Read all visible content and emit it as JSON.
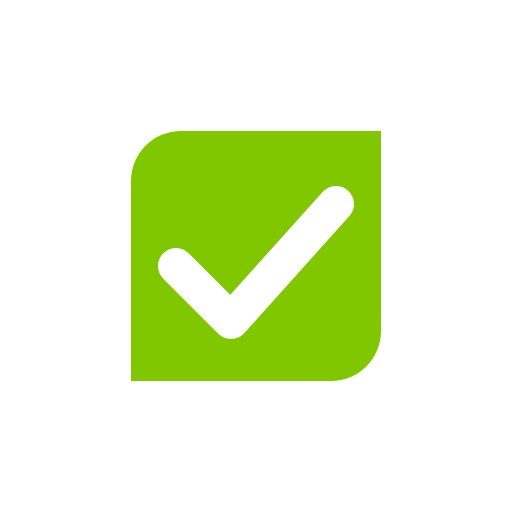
{
  "logo": {
    "name": "checkmark-logo",
    "icon": "checkmark-icon",
    "colors": {
      "tile": "#80c700",
      "check": "#ffffff",
      "background": "#ffffff"
    }
  }
}
